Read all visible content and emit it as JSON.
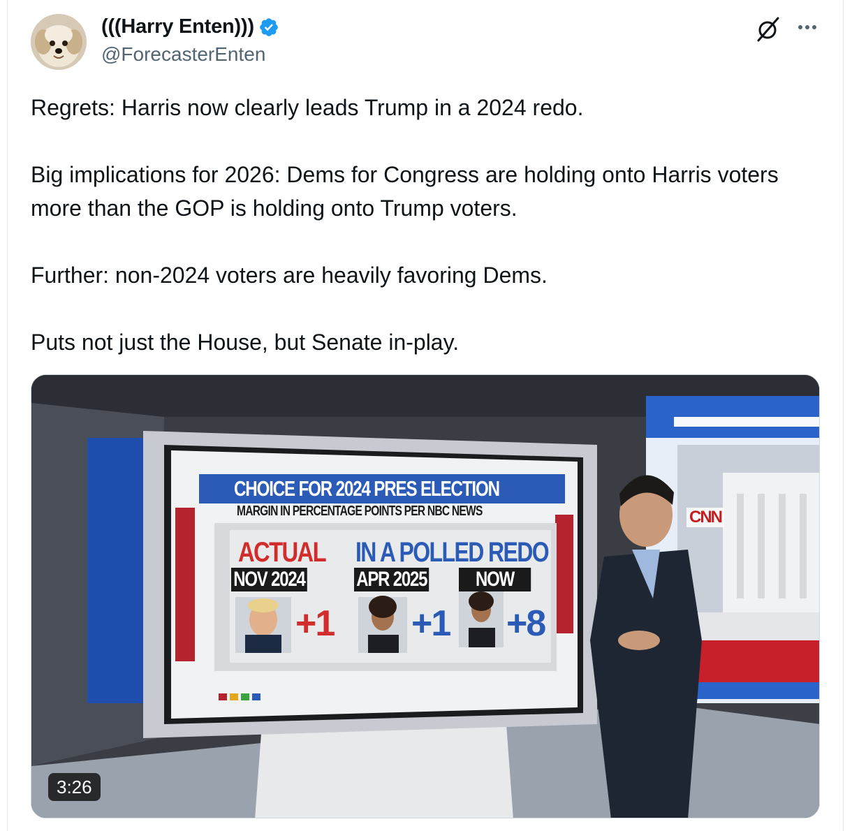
{
  "author": {
    "display_name": "(((Harry Enten)))",
    "handle": "@ForecasterEnten",
    "verified": true
  },
  "icons": {
    "verified": "verified-badge-icon",
    "grok": "grok-icon",
    "more": "more-options-icon"
  },
  "tweet": {
    "paragraphs": [
      "Regrets: Harris now clearly leads Trump in a 2024 redo.",
      "Big implications for 2026: Dems for Congress are holding onto Harris voters more than the GOP is holding onto Trump voters.",
      "Further: non-2024 voters are heavily favoring Dems.",
      "Puts not just the House, but Senate in-play."
    ]
  },
  "video": {
    "duration": "3:26",
    "screen": {
      "title": "CHOICE FOR 2024 PRES ELECTION",
      "subtitle": "MARGIN IN PERCENTAGE POINTS PER NBC NEWS",
      "actual_label": "ACTUAL",
      "redo_label": "IN A POLLED REDO",
      "columns": [
        {
          "date": "NOV 2024",
          "margin": "+1",
          "candidate": "Trump"
        },
        {
          "date": "APR 2025",
          "margin": "+1",
          "candidate": "Harris"
        },
        {
          "date": "NOW",
          "margin": "+8",
          "candidate": "Harris"
        }
      ]
    },
    "network_logo": "CNN"
  },
  "colors": {
    "verified_blue": "#1d9bf0",
    "handle_gray": "#536471",
    "republican_red": "#d22d2d",
    "democrat_blue": "#2b5bb6"
  }
}
